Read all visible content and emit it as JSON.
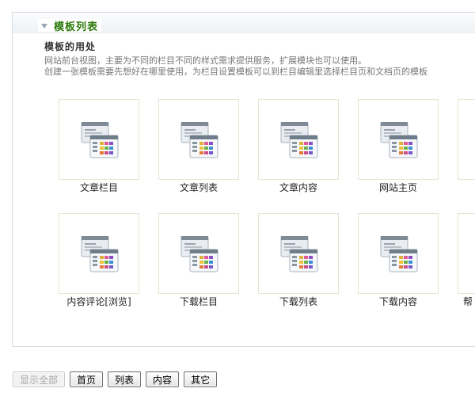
{
  "panel": {
    "title": "模板列表",
    "intro_heading": "模板的用处",
    "intro_lines": [
      "网站前台视图，主要为不同的栏目不同的样式需求提供服务，扩展模块也可以使用。",
      "创建一张模板需要先想好在哪里使用，为栏目设置模板可以到栏目编辑里选择栏目页和文档页的模板"
    ]
  },
  "templates": [
    {
      "label": "文章栏目",
      "icon": "template-icon"
    },
    {
      "label": "文章列表",
      "icon": "template-icon"
    },
    {
      "label": "文章内容",
      "icon": "template-icon"
    },
    {
      "label": "网站主页",
      "icon": "template-icon"
    },
    {
      "label": "",
      "icon": "template-icon"
    },
    {
      "label": "内容评论[浏览]",
      "icon": "template-icon"
    },
    {
      "label": "下载栏目",
      "icon": "template-icon"
    },
    {
      "label": "下载列表",
      "icon": "template-icon"
    },
    {
      "label": "下载内容",
      "icon": "template-icon"
    },
    {
      "label": "帮",
      "icon": "template-icon"
    }
  ],
  "footer": {
    "show_all": "显示全部",
    "home": "首页",
    "list": "列表",
    "content": "内容",
    "other": "其它"
  },
  "colors": {
    "title_green": "#2b7a0b",
    "tile_border": "#e8e2cf",
    "panel_border": "#d6dde4"
  }
}
